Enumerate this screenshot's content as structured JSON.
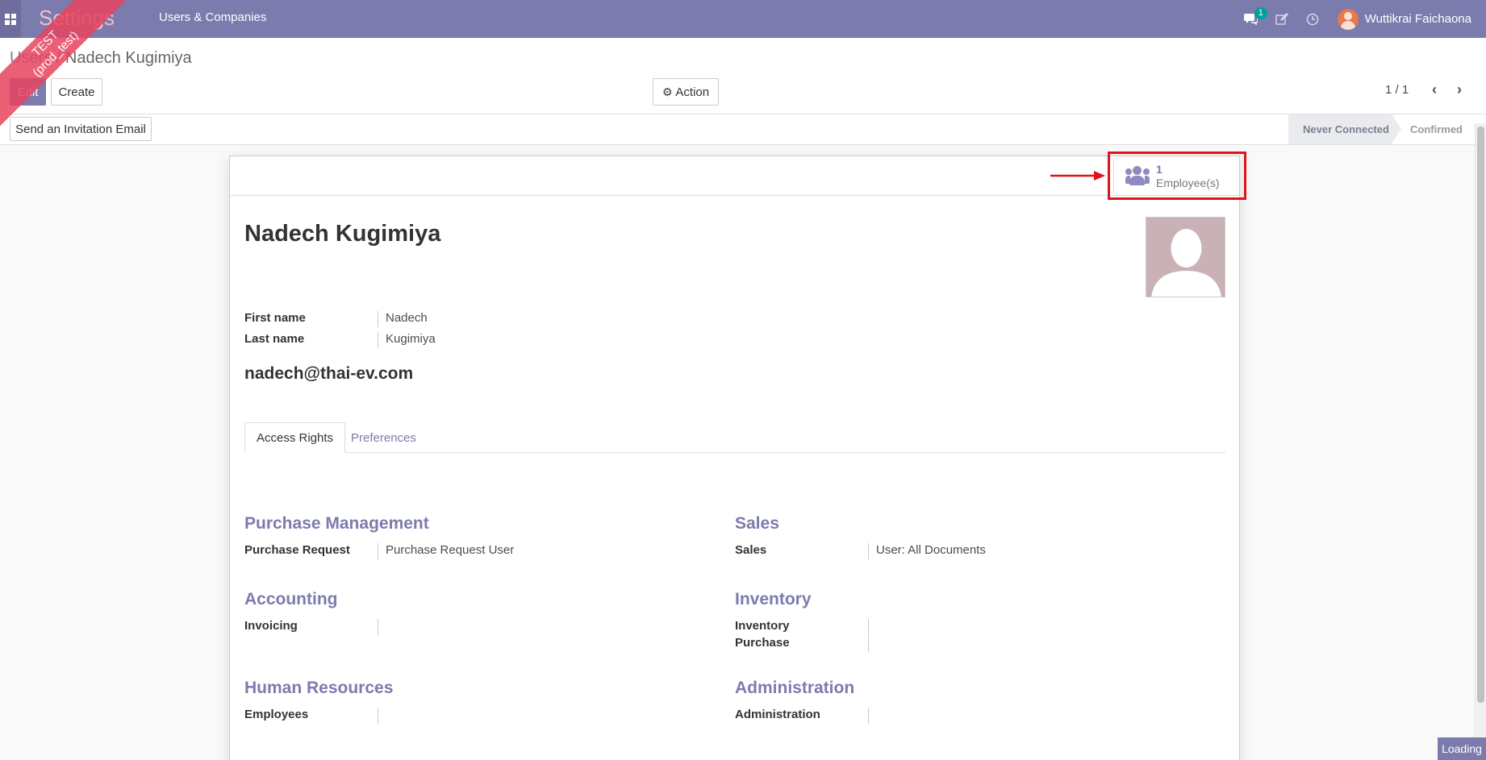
{
  "navbar": {
    "app_title": "Settings",
    "menu_item": "Users & Companies",
    "messages_badge": "1",
    "user_name": "Wuttikrai Faichaona"
  },
  "ribbon": {
    "line1": "TEST",
    "line2": "(prod_test)"
  },
  "breadcrumb": {
    "parent": "Users",
    "separator": "/",
    "current": "Nadech Kugimiya"
  },
  "toolbar": {
    "edit_label": "Edit",
    "create_label": "Create",
    "action_label": "Action",
    "pager": "1 / 1"
  },
  "statusbar": {
    "invite_label": "Send an Invitation Email",
    "stages": [
      "Never Connected",
      "Confirmed"
    ],
    "active_stage": "Never Connected"
  },
  "smart_button": {
    "count": "1",
    "label": "Employee(s)"
  },
  "form": {
    "name": "Nadech Kugimiya",
    "first_name_label": "First name",
    "first_name": "Nadech",
    "last_name_label": "Last name",
    "last_name": "Kugimiya",
    "email": "nadech@thai-ev.com"
  },
  "tabs": {
    "access_rights": "Access Rights",
    "preferences": "Preferences"
  },
  "access_groups": {
    "purchase_management": {
      "title": "Purchase Management",
      "fields": [
        {
          "label": "Purchase Request",
          "value": "Purchase Request User"
        }
      ]
    },
    "sales": {
      "title": "Sales",
      "fields": [
        {
          "label": "Sales",
          "value": "User: All Documents"
        }
      ]
    },
    "accounting": {
      "title": "Accounting",
      "fields": [
        {
          "label": "Invoicing",
          "value": ""
        }
      ]
    },
    "inventory": {
      "title": "Inventory",
      "fields": [
        {
          "label": "Inventory",
          "value": ""
        },
        {
          "label": "Purchase",
          "value": ""
        }
      ]
    },
    "human_resources": {
      "title": "Human Resources",
      "fields": [
        {
          "label": "Employees",
          "value": ""
        }
      ]
    },
    "administration": {
      "title": "Administration",
      "fields": [
        {
          "label": "Administration",
          "value": ""
        }
      ]
    }
  },
  "loading_label": "Loading",
  "colors": {
    "brand": "#7c7bad",
    "highlight": "#e01418"
  }
}
